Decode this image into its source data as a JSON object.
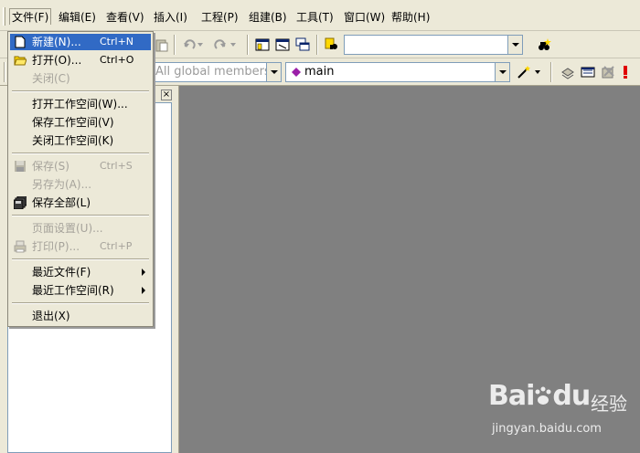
{
  "menubar": {
    "items": [
      {
        "label": "文件(F)",
        "active": true
      },
      {
        "label": "编辑(E)"
      },
      {
        "label": "查看(V)"
      },
      {
        "label": "插入(I)"
      },
      {
        "label": "工程(P)"
      },
      {
        "label": "组建(B)"
      },
      {
        "label": "工具(T)"
      },
      {
        "label": "窗口(W)"
      },
      {
        "label": "帮助(H)"
      }
    ]
  },
  "toolbar": {
    "find_combo_value": "",
    "class_combo_value": "All global members",
    "function_combo_value": "main"
  },
  "file_menu": {
    "items": [
      {
        "label": "新建(N)...",
        "shortcut": "Ctrl+N",
        "icon": "new-file-icon",
        "state": "highlighted"
      },
      {
        "label": "打开(O)...",
        "shortcut": "Ctrl+O",
        "icon": "open-folder-icon",
        "state": "enabled"
      },
      {
        "label": "关闭(C)",
        "shortcut": "",
        "state": "disabled"
      },
      {
        "label": "打开工作空间(W)...",
        "shortcut": "",
        "state": "enabled"
      },
      {
        "label": "保存工作空间(V)",
        "shortcut": "",
        "state": "enabled"
      },
      {
        "label": "关闭工作空间(K)",
        "shortcut": "",
        "state": "enabled"
      },
      {
        "label": "保存(S)",
        "shortcut": "Ctrl+S",
        "icon": "save-icon",
        "state": "disabled"
      },
      {
        "label": "另存为(A)...",
        "shortcut": "",
        "state": "disabled"
      },
      {
        "label": "保存全部(L)",
        "shortcut": "",
        "icon": "save-all-icon",
        "state": "enabled"
      },
      {
        "label": "页面设置(U)...",
        "shortcut": "",
        "state": "disabled"
      },
      {
        "label": "打印(P)...",
        "shortcut": "Ctrl+P",
        "icon": "print-icon",
        "state": "disabled"
      },
      {
        "label": "最近文件(F)",
        "shortcut": "",
        "submenu": true,
        "state": "enabled"
      },
      {
        "label": "最近工作空间(R)",
        "shortcut": "",
        "submenu": true,
        "state": "enabled"
      },
      {
        "label": "退出(X)",
        "shortcut": "",
        "state": "enabled"
      }
    ]
  },
  "workspace": {
    "close_label": "×"
  },
  "watermark": {
    "brand": "Bai",
    "brand_suffix": "du",
    "cn": "经验",
    "url": "jingyan.baidu.com"
  },
  "colors": {
    "chrome": "#ece9d8",
    "highlight": "#316ac5",
    "mdi_background": "#808080",
    "disabled_text": "#a6a39b"
  }
}
